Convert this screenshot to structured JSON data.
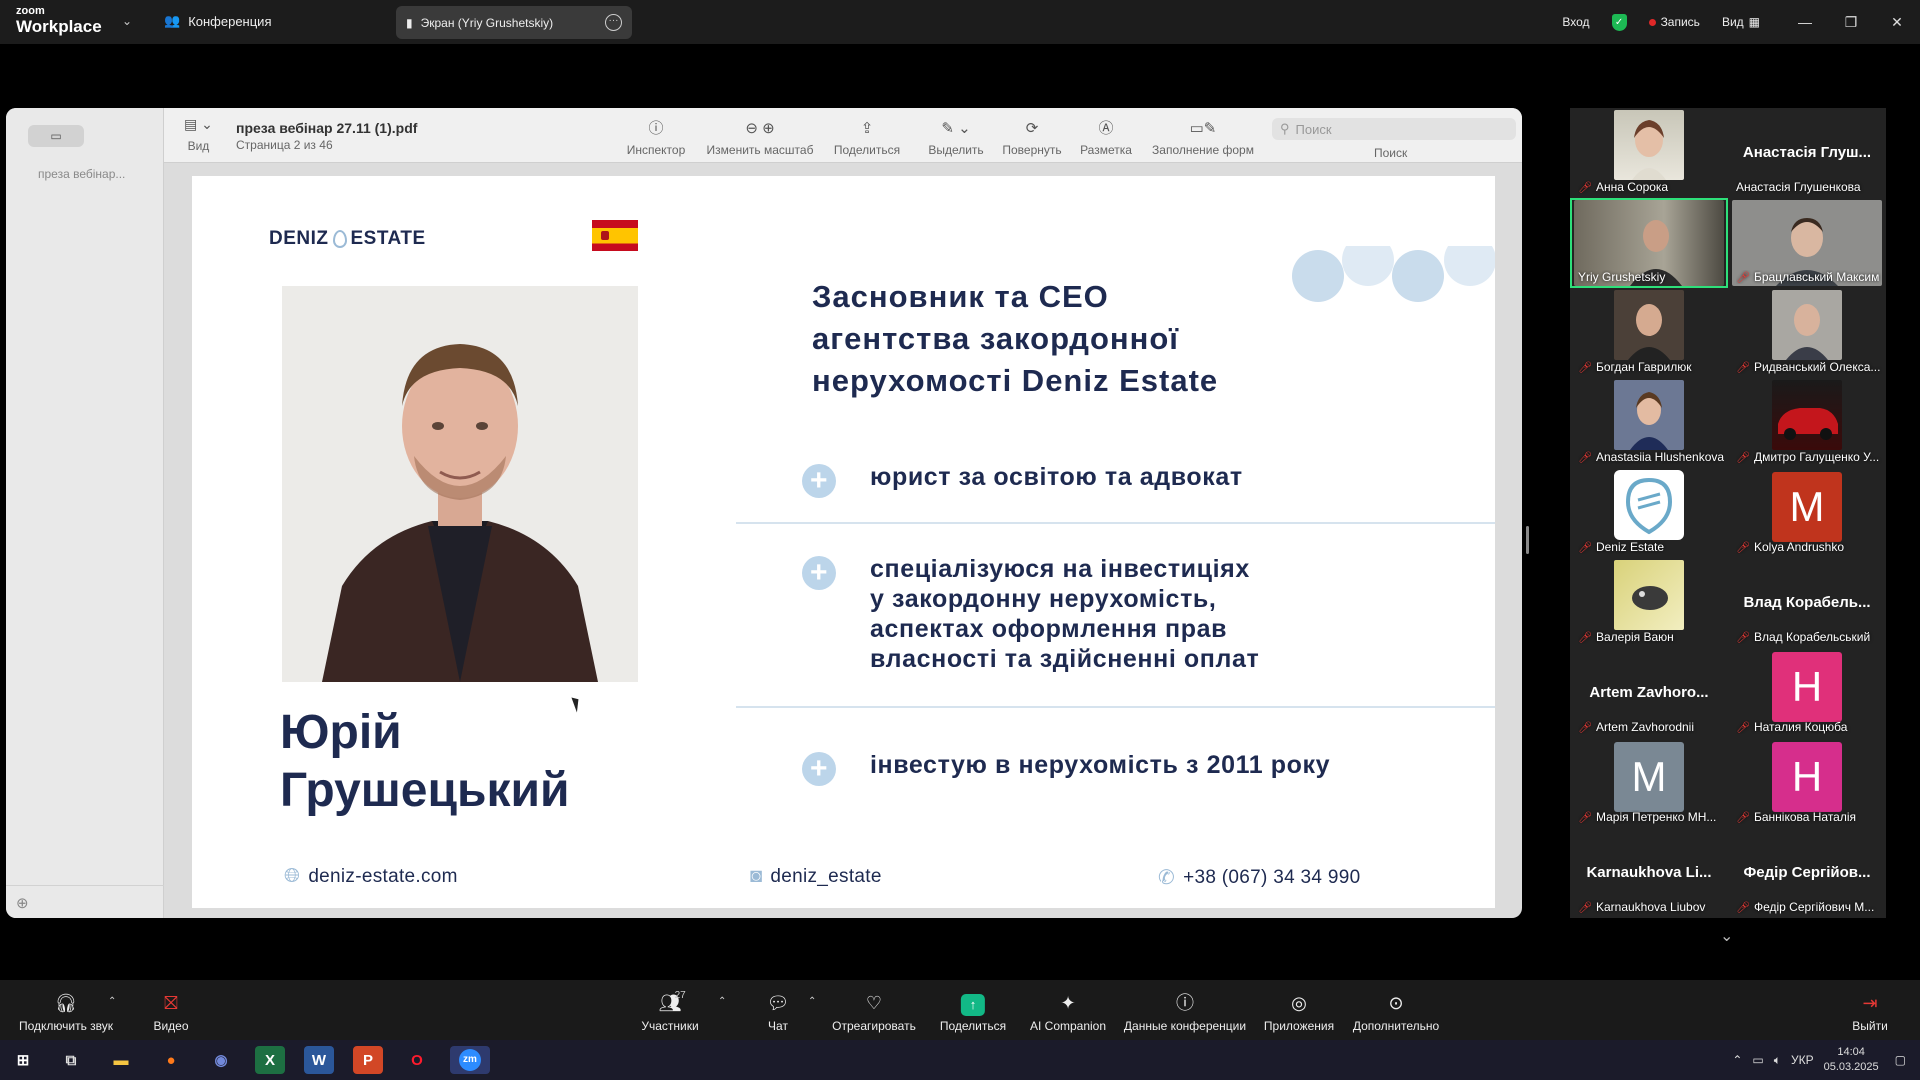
{
  "topbar": {
    "logo_top": "zoom",
    "logo_main": "Workplace",
    "meeting_label": "Конференция",
    "screen_share_label": "Экран (Yriy Grushetskiy)",
    "signin_label": "Вход",
    "record_label": "Запись",
    "view_label": "Вид",
    "accent_color": "#1db954"
  },
  "viewer": {
    "sidebar_thumb": "преза вебінар...",
    "view_label": "Вид",
    "file_name": "преза вебінар 27.11 (1).pdf",
    "page_info": "Страница 2 из 46",
    "tools": {
      "inspector": "Инспектор",
      "zoom": "Изменить масштаб",
      "share": "Поделиться",
      "highlight": "Выделить",
      "rotate": "Повернуть",
      "markup": "Разметка",
      "forms": "Заполнение форм"
    },
    "search_placeholder": "Поиск",
    "search_label": "Поиск"
  },
  "slide": {
    "brand_left": "DENIZ",
    "brand_right": "ESTATE",
    "name_line1": "Юрій",
    "name_line2": "Грушецький",
    "headline_line1": "Засновник та CEO",
    "headline_line2": "агентства закордонної",
    "headline_line3": "нерухомості Deniz Estate",
    "bullet1": "юрист за освітою та адвокат",
    "bullet2_line1": "спеціалізуюся на інвестиціях",
    "bullet2_line2": "у закордонну нерухомість,",
    "bullet2_line3": "аспектах оформлення прав",
    "bullet2_line4": "власності та здійсненні оплат",
    "bullet3": "інвестую в нерухомість з 2011 року",
    "website": "deniz-estate.com",
    "instagram": "deniz_estate",
    "phone": "+38 (067) 34 34 990",
    "brand_color": "#1e2a50",
    "accent_color": "#bcd5ea"
  },
  "participants": [
    {
      "label": "Анна Сорока",
      "big": ""
    },
    {
      "label": "Анастасія Глушенкова",
      "big": "Анастасія Глуш..."
    },
    {
      "label": "Yriy Grushetskiy",
      "big": ""
    },
    {
      "label": "Брацлавський Максим",
      "big": ""
    },
    {
      "label": "Богдан Гаврилюк",
      "big": ""
    },
    {
      "label": "Ридванський Олекса...",
      "big": ""
    },
    {
      "label": "Anastasiia Hlushenkova",
      "big": ""
    },
    {
      "label": "Дмитро Галущенко У...",
      "big": ""
    },
    {
      "label": "Deniz Estate",
      "big": ""
    },
    {
      "label": "Kolya Andrushko",
      "big": "M"
    },
    {
      "label": "Валерія Ваюн",
      "big": ""
    },
    {
      "label": "Влад Корабельський",
      "big": "Влад Корабель..."
    },
    {
      "label": "Artem Zavhorodnii",
      "big": "Artem Zavhoro..."
    },
    {
      "label": "Наталия Коцюба",
      "big": "H"
    },
    {
      "label": "Марія Петренко МН...",
      "big": "M"
    },
    {
      "label": "Баннікова Наталія",
      "big": "H"
    },
    {
      "label": "Karnaukhova Liubov",
      "big": "Karnaukhova Li..."
    },
    {
      "label": "Федір Сергійович М...",
      "big": "Федір Сергійов..."
    }
  ],
  "controls": {
    "audio": "Подключить звук",
    "video": "Видео",
    "participants": "Участники",
    "participants_count": "27",
    "chat": "Чат",
    "react": "Отреагировать",
    "share": "Поделиться",
    "ai": "AI Companion",
    "info": "Данные конференции",
    "apps": "Приложения",
    "more": "Дополнительно",
    "leave": "Выйти"
  },
  "taskbar": {
    "lang": "УКР",
    "time": "14:04",
    "date": "05.03.2025"
  }
}
